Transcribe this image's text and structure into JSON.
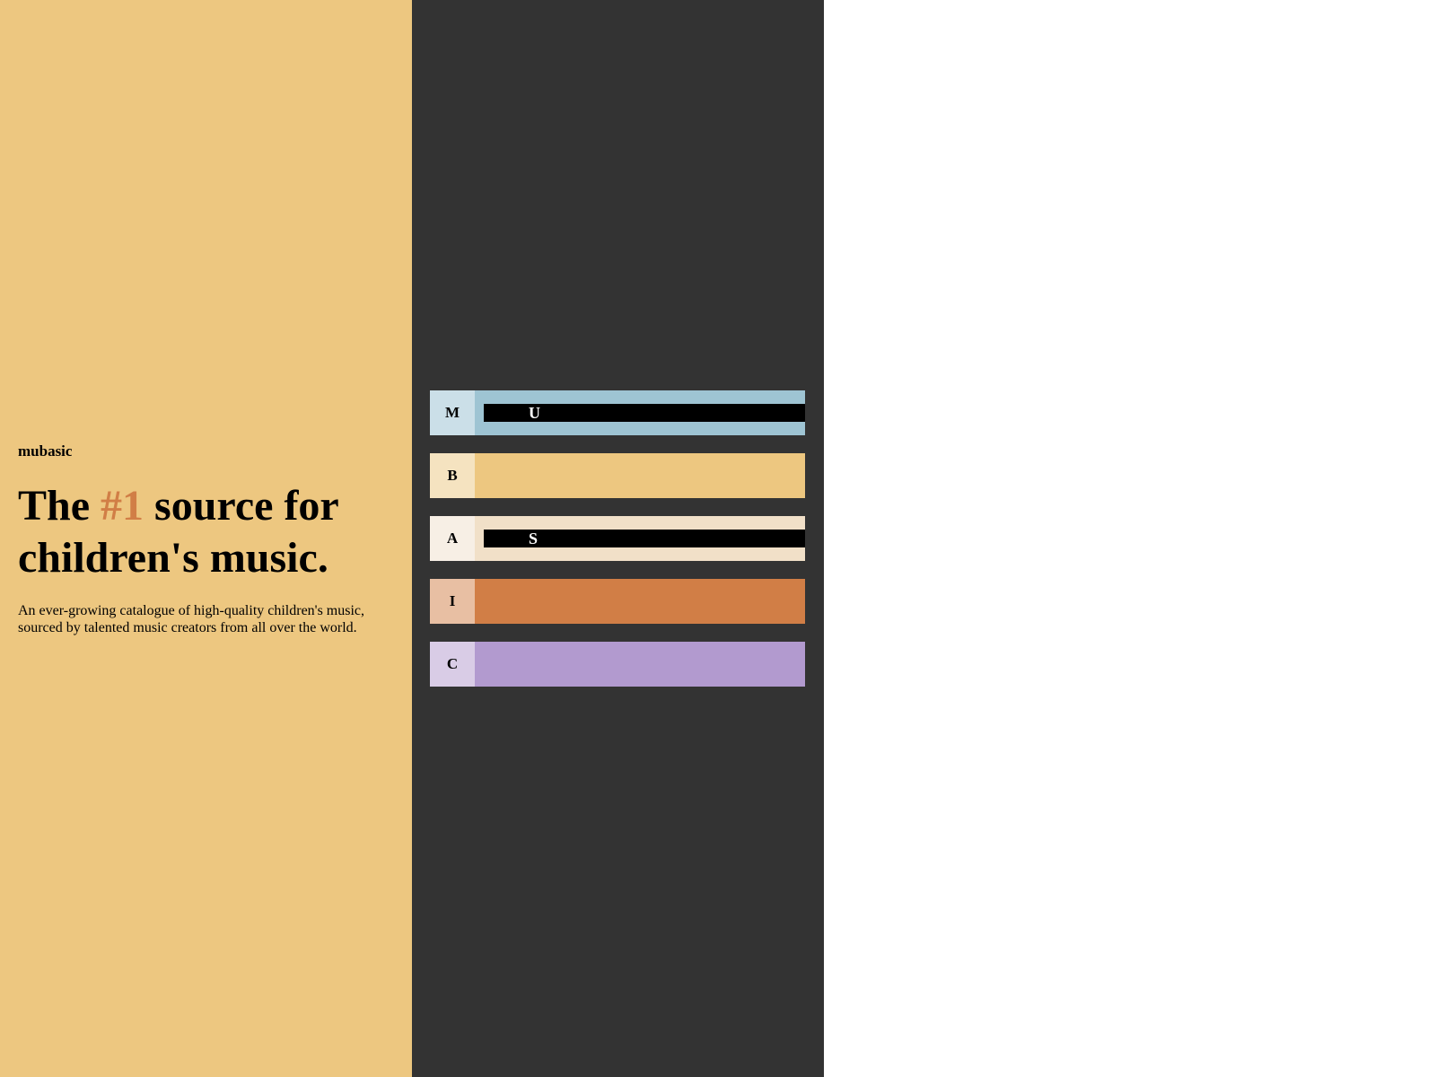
{
  "hero": {
    "brand": "mubasic",
    "headline_before": "The ",
    "headline_accent": "#1",
    "headline_after": " source for children's music.",
    "description": "An ever-growing catalogue of high-quality children's music, sourced by talented music creators from all over the world."
  },
  "rows": [
    {
      "key": "M",
      "tag": "U",
      "key_color": "#cbdfe8",
      "bar_color": "#9ec4d3"
    },
    {
      "key": "B",
      "tag": "",
      "key_color": "#f5e3c0",
      "bar_color": "#edc780"
    },
    {
      "key": "A",
      "tag": "S",
      "key_color": "#f7efe5",
      "bar_color": "#f1e0c8"
    },
    {
      "key": "I",
      "tag": "",
      "key_color": "#e8bfa3",
      "bar_color": "#d17e46"
    },
    {
      "key": "C",
      "tag": "",
      "key_color": "#d9cce6",
      "bar_color": "#b29acf"
    }
  ],
  "colors": {
    "left_panel": "#edc780",
    "middle_panel": "#333333",
    "accent": "#d17e46"
  }
}
